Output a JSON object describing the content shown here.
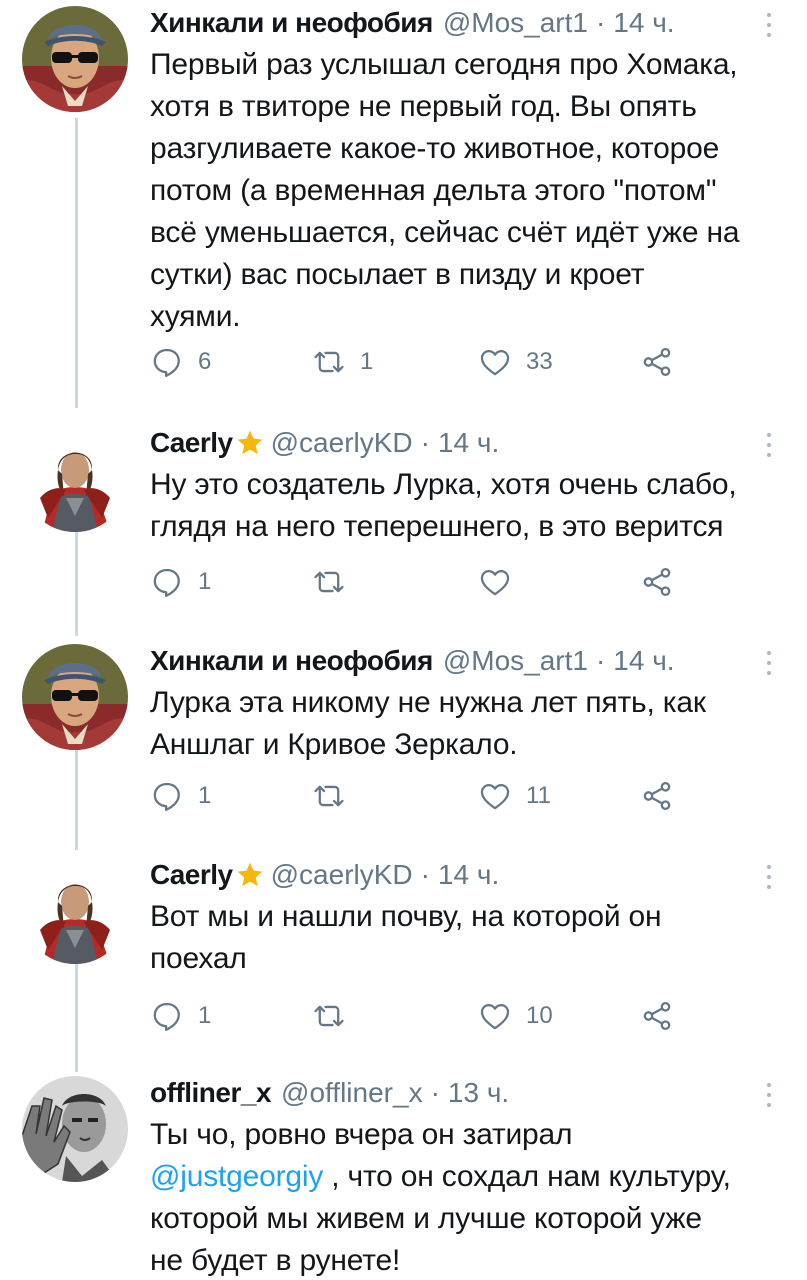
{
  "tweets": [
    {
      "name": "Хинкали и неофобия",
      "handle": "@Mos_art1",
      "sep": "·",
      "time": "14 ч.",
      "text_lines": [
        "Первый раз услышал сегодня про Хомака,",
        "хотя в твиторе не первый год. Вы опять",
        "разгуливаете какое-то животное, которое",
        "потом (а временная дельта этого \"потом\"",
        "всё уменьшается, сейчас счёт идёт уже на",
        "сутки) вас посылает в пизду и кроет",
        "хуями."
      ],
      "replies": "6",
      "retweets": "1",
      "likes": "33",
      "avatar": "sunglasses-portrait-avatar"
    },
    {
      "name": "Caerly",
      "verified_star": true,
      "handle": "@caerlyKD",
      "sep": "·",
      "time": "14 ч.",
      "text_lines": [
        "Ну это создатель Лурка, хотя очень слабо,",
        "глядя на него теперешнего, в это верится"
      ],
      "replies": "1",
      "retweets": "",
      "likes": "",
      "avatar": "red-cloak-warrior-avatar"
    },
    {
      "name": "Хинкали и неофобия",
      "handle": "@Mos_art1",
      "sep": "·",
      "time": "14 ч.",
      "text_lines": [
        "Лурка эта никому не нужна лет пять, как",
        "Аншлаг и Кривое Зеркало."
      ],
      "replies": "1",
      "retweets": "",
      "likes": "11",
      "avatar": "sunglasses-portrait-avatar"
    },
    {
      "name": "Caerly",
      "verified_star": true,
      "handle": "@caerlyKD",
      "sep": "·",
      "time": "14 ч.",
      "text_lines": [
        "Вот мы и нашли почву, на которой он",
        "поехал"
      ],
      "replies": "1",
      "retweets": "",
      "likes": "10",
      "avatar": "red-cloak-warrior-avatar"
    },
    {
      "name": "offliner_x",
      "handle": "@offliner_x",
      "sep": "·",
      "time": "13 ч.",
      "text_lines": [
        "Ты чо, ровно вчера он затирал"
      ],
      "mention": "@justgeorgiy",
      "text_after_mention": " , что он сохдал нам культуру,",
      "text_lines_tail": [
        "которой мы живем и лучше которой уже",
        "не будет в рунете!"
      ],
      "avatar": "bw-face-hand-avatar"
    }
  ],
  "colors": {
    "text": "#14171a",
    "secondary": "#657786",
    "link": "#1da1f2",
    "thread_line": "#ccd6dd",
    "star": "#f5b70a"
  }
}
